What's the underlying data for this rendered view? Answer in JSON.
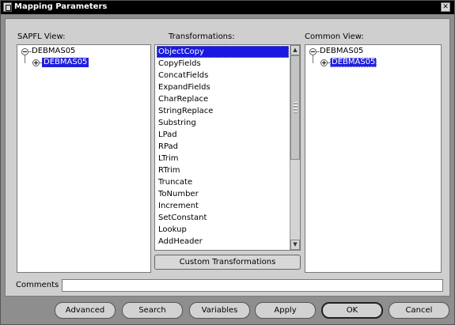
{
  "window": {
    "title": "Mapping Parameters",
    "close_glyph": "✕"
  },
  "sapfl_view": {
    "label": "SAPFL View:",
    "root": "DEBMAS05",
    "child": "DEBMAS05"
  },
  "transformations": {
    "label": "Transformations:",
    "items": [
      "ObjectCopy",
      "CopyFields",
      "ConcatFields",
      "ExpandFields",
      "CharReplace",
      "StringReplace",
      "Substring",
      "LPad",
      "RPad",
      "LTrim",
      "RTrim",
      "Truncate",
      "ToNumber",
      "Increment",
      "SetConstant",
      "Lookup",
      "AddHeader"
    ],
    "selected_index": 0,
    "custom_button": "Custom Transformations"
  },
  "common_view": {
    "label": "Common View:",
    "root": "DEBMAS05",
    "child": "DEBMAS05"
  },
  "comments": {
    "label": "Comments",
    "value": ""
  },
  "buttons": {
    "advanced": "Advanced",
    "search": "Search",
    "variables": "Variables",
    "apply": "Apply",
    "ok": "OK",
    "cancel": "Cancel"
  },
  "icons": {
    "window_icon": "app-window-icon",
    "close": "close-icon",
    "tree_expanded": "minus-circle-icon",
    "tree_collapsed": "plus-circle-icon",
    "scroll_up": "arrow-up-icon",
    "scroll_down": "arrow-down-icon"
  },
  "colors": {
    "selection": "#1818e0",
    "titlebar": "#000000",
    "dialog_bg": "#cfcfcf"
  }
}
